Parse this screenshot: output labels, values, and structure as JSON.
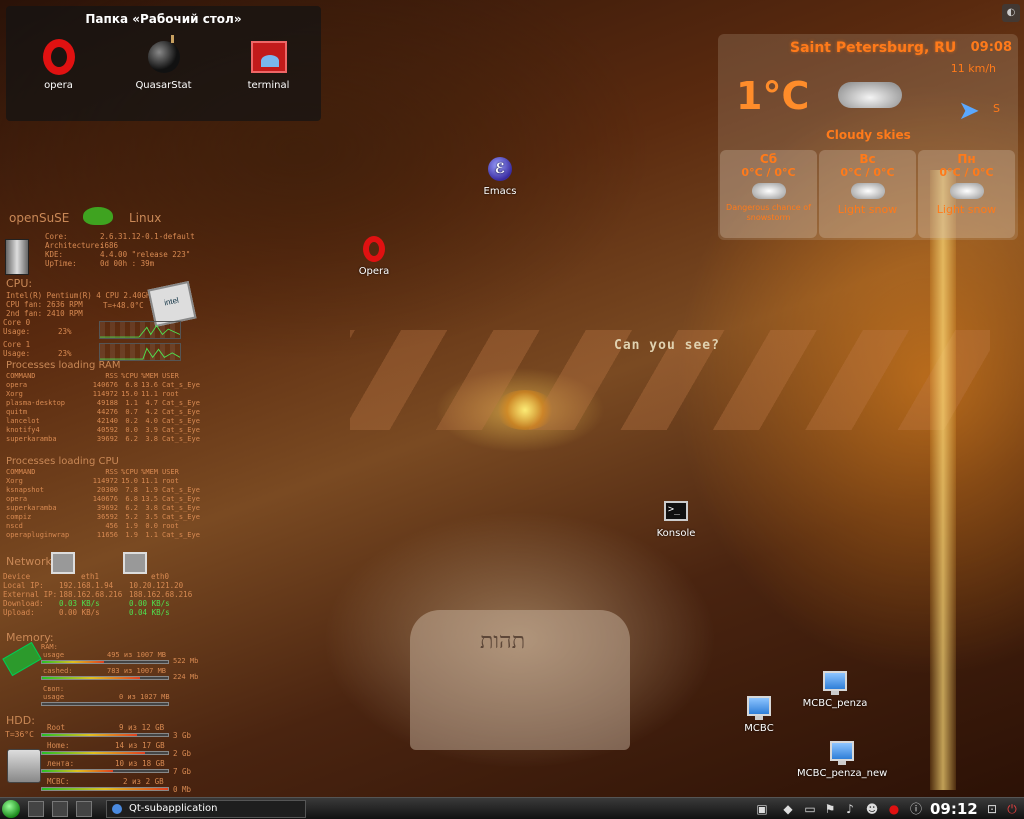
{
  "folder": {
    "title": "Папка «Рабочий стол»",
    "icons": [
      {
        "label": "opera",
        "icon": "opera-icon"
      },
      {
        "label": "QuasarStat",
        "icon": "bomb-icon"
      },
      {
        "label": "terminal",
        "icon": "terminal-icon"
      }
    ]
  },
  "desktop_icons": {
    "emacs": "Emacs",
    "opera": "Opera",
    "konsole": "Konsole",
    "mcbc": "МСВС",
    "mcbc_penza": "МСВС_penza",
    "mcbc_penza_new": "МСВС_penza_new"
  },
  "wallpaper_text": {
    "can_you": "Can you see?",
    "hebrew": "תהות"
  },
  "weather": {
    "city": "Saint Petersburg, RU",
    "time": "09:08",
    "wind": "11 km/h",
    "temp": "1°C",
    "direction": "S",
    "condition": "Cloudy skies",
    "days": [
      {
        "name": "Сб",
        "temps": "0°C / 0°C",
        "desc": "Dangerous chance of snowstorm"
      },
      {
        "name": "Вс",
        "temps": "0°C / 0°C",
        "desc": "Light snow"
      },
      {
        "name": "Пн",
        "temps": "0°C / 0°C",
        "desc": "Light snow"
      }
    ]
  },
  "sysmon": {
    "os": "openSuSE",
    "kernel": "Linux",
    "info": [
      {
        "k": "Core:",
        "v": "2.6.31.12-0.1-default"
      },
      {
        "k": "Architecture:",
        "v": "i686"
      },
      {
        "k": "KDE:",
        "v": "4.4.00 \"release 223\""
      },
      {
        "k": "UpTime:",
        "v": "0d  00h : 39m"
      }
    ],
    "cpu_head": "CPU:",
    "cpu_model": "Intel(R) Pentium(R) 4 CPU 2.40GHz",
    "cpu_fan": "CPU fan:    2636 RPM",
    "fan2": "2nd fan:    2410 RPM",
    "cpu_temp": "T=+48.0°C",
    "core0_label": "Core 0",
    "core0_usage_label": "Usage:",
    "core0_usage": "23%",
    "core1_label": "Core 1",
    "core1_usage_label": "Usage:",
    "core1_usage": "23%",
    "ram_proc_head": "Processes loading RAM",
    "ram_proc_cols": [
      "COMMAND",
      "RSS",
      "%CPU",
      "%MEM",
      "USER"
    ],
    "ram_procs": [
      [
        "opera",
        "140676",
        "6.8",
        "13.6",
        "Cat_s_Eye"
      ],
      [
        "Xorg",
        "114972",
        "15.0",
        "11.1",
        "root"
      ],
      [
        "plasma-desktop",
        "49188",
        "1.1",
        "4.7",
        "Cat_s_Eye"
      ],
      [
        "quitm",
        "44276",
        "0.7",
        "4.2",
        "Cat_s_Eye"
      ],
      [
        "lancelot",
        "42140",
        "0.2",
        "4.0",
        "Cat_s_Eye"
      ],
      [
        "knotify4",
        "40592",
        "0.0",
        "3.9",
        "Cat_s_Eye"
      ],
      [
        "superkaramba",
        "39692",
        "6.2",
        "3.8",
        "Cat_s_Eye"
      ]
    ],
    "cpu_proc_head": "Processes loading CPU",
    "cpu_proc_cols": [
      "COMMAND",
      "RSS",
      "%CPU",
      "%MEM",
      "USER"
    ],
    "cpu_procs": [
      [
        "Xorg",
        "114972",
        "15.0",
        "11.1",
        "root"
      ],
      [
        "ksnapshot",
        "20300",
        "7.8",
        "1.9",
        "Cat_s_Eye"
      ],
      [
        "opera",
        "140676",
        "6.8",
        "13.5",
        "Cat_s_Eye"
      ],
      [
        "superkaramba",
        "39692",
        "6.2",
        "3.8",
        "Cat_s_Eye"
      ],
      [
        "compiz",
        "36592",
        "5.2",
        "3.5",
        "Cat_s_Eye"
      ],
      [
        "nscd",
        "456",
        "1.9",
        "0.0",
        "root"
      ],
      [
        "operapluginwrap",
        "11656",
        "1.9",
        "1.1",
        "Cat_s_Eye"
      ]
    ],
    "net_head": "Network:",
    "net": {
      "device_label": "Device",
      "dev1": "eth1",
      "dev2": "eth0",
      "local_label": "Local IP:",
      "local1": "192.168.1.94",
      "local2": "10.20.121.20",
      "ext_label": "External IP:",
      "ext1": "188.162.68.216",
      "ext2": "188.162.68.216",
      "down_label": "Download:",
      "down1": "0.03 KB/s",
      "down2": "0.00 KB/s",
      "up_label": "Upload:",
      "up1": "0.00 KB/s",
      "up2": "0.04 KB/s"
    },
    "mem_head": "Memory:",
    "ram_label": "RAM:",
    "ram_usage_label": "usage",
    "ram_usage": "495 из 1007 MB",
    "ram_usage_free": "522 Mb",
    "ram_usage_pct": 0.49,
    "cached_label": "cashed:",
    "cached": "783 из 1007 MB",
    "cached_free": "224 Mb",
    "cached_pct": 0.78,
    "swap_label": "Своп:",
    "swap_usage_label": "usage",
    "swap": "0 из 1027 MB",
    "swap_pct": 0.0,
    "hdd_head": "HDD:",
    "hdd_temp": "T=36°C",
    "disks": [
      {
        "name": "Root",
        "usage": "9 из 12 GB",
        "free": "3 Gb",
        "pct": 0.75
      },
      {
        "name": "Home:",
        "usage": "14 из 17 GB",
        "free": "2 Gb",
        "pct": 0.82
      },
      {
        "name": "лента:",
        "usage": "10 из 18 GB",
        "free": "7 Gb",
        "pct": 0.56
      },
      {
        "name": "МСВС:",
        "usage": "2 из 2 GB",
        "free": "0 Mb",
        "pct": 1.0
      }
    ]
  },
  "taskbar": {
    "task_label": "Qt-subapplication",
    "clock": "09:12"
  }
}
